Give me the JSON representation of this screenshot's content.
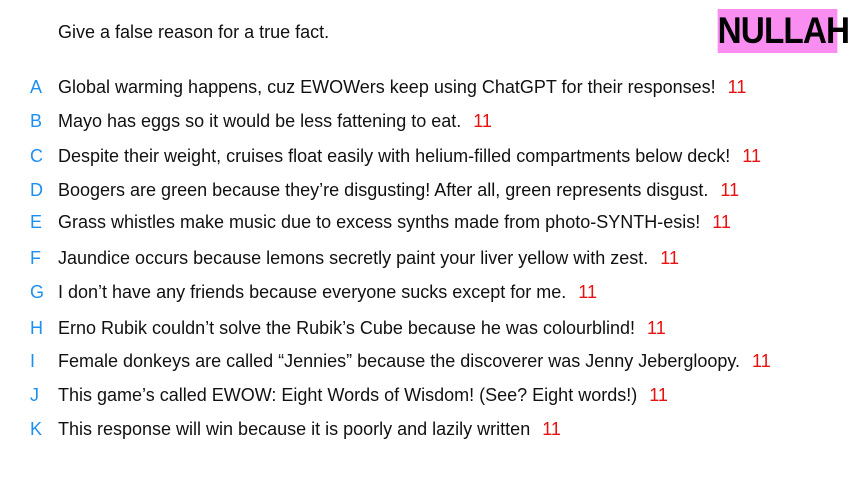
{
  "prompt": "Give a false reason for a true fact.",
  "badge": "NULLAH",
  "colors": {
    "letter": "#1e8ff2",
    "score": "#e81010",
    "badge_bg": "#f98ef0"
  },
  "responses": [
    {
      "letter": "A",
      "text": "Global warming happens, cuz EWOWers keep using ChatGPT for their responses!",
      "score": "11"
    },
    {
      "letter": "B",
      "text": "Mayo has eggs so it would be less fattening to eat.",
      "score": "11"
    },
    {
      "letter": "C",
      "text": "Despite their weight, cruises float easily with helium-filled compartments below deck!",
      "score": "11"
    },
    {
      "letter": "D",
      "text": "Boogers are green because they’re disgusting! After all, green represents disgust.",
      "score": "11"
    },
    {
      "letter": "E",
      "text": "Grass whistles make music due to excess synths made from photo-SYNTH-esis!",
      "score": "11"
    },
    {
      "letter": "F",
      "text": "Jaundice occurs because lemons secretly paint your liver yellow with zest.",
      "score": "11"
    },
    {
      "letter": "G",
      "text": "I don’t have any friends because everyone sucks except for me.",
      "score": "11"
    },
    {
      "letter": "H",
      "text": "Erno Rubik couldn’t solve the Rubik’s Cube because he was colourblind!",
      "score": "11"
    },
    {
      "letter": "I",
      "text": "Female donkeys are called “Jennies” because the discoverer was Jenny Jebergloopy.",
      "score": "11"
    },
    {
      "letter": "J",
      "text": "This game’s called EWOW: Eight Words of Wisdom! (See? Eight words!)",
      "score": "11"
    },
    {
      "letter": "K",
      "text": "This response will win because it is poorly and lazily written",
      "score": "11"
    }
  ]
}
